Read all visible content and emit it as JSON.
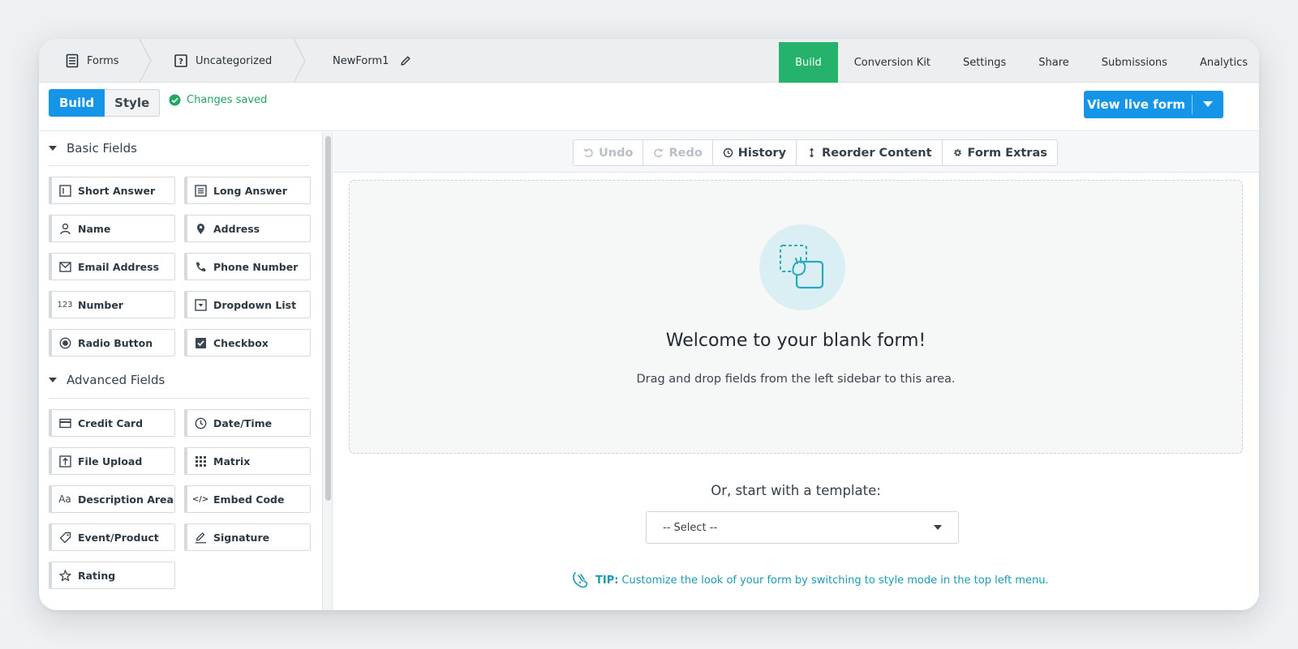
{
  "breadcrumbs": [
    {
      "label": "Forms",
      "icon": "form-doc-icon"
    },
    {
      "label": "Uncategorized",
      "icon": "folder-question-icon"
    },
    {
      "label": "NewForm1",
      "icon": "pencil-icon"
    }
  ],
  "nav_tabs": [
    {
      "label": "Build",
      "active": true
    },
    {
      "label": "Conversion Kit"
    },
    {
      "label": "Settings"
    },
    {
      "label": "Share"
    },
    {
      "label": "Submissions"
    },
    {
      "label": "Analytics"
    }
  ],
  "mode": {
    "build": "Build",
    "style": "Style"
  },
  "status": "Changes saved",
  "live_button": "View live form",
  "sections": {
    "basic": "Basic Fields",
    "advanced": "Advanced Fields"
  },
  "basic_fields": [
    {
      "label": "Short Answer",
      "icon": "short-answer-icon"
    },
    {
      "label": "Long Answer",
      "icon": "long-answer-icon"
    },
    {
      "label": "Name",
      "icon": "person-icon"
    },
    {
      "label": "Address",
      "icon": "map-pin-icon"
    },
    {
      "label": "Email Address",
      "icon": "envelope-icon"
    },
    {
      "label": "Phone Number",
      "icon": "phone-icon"
    },
    {
      "label": "Number",
      "icon": "number-123-icon",
      "glyph": "123"
    },
    {
      "label": "Dropdown List",
      "icon": "dropdown-icon"
    },
    {
      "label": "Radio Button",
      "icon": "radio-icon"
    },
    {
      "label": "Checkbox",
      "icon": "checkbox-icon"
    }
  ],
  "advanced_fields": [
    {
      "label": "Credit Card",
      "icon": "credit-card-icon"
    },
    {
      "label": "Date/Time",
      "icon": "clock-icon"
    },
    {
      "label": "File Upload",
      "icon": "file-upload-icon"
    },
    {
      "label": "Matrix",
      "icon": "matrix-grid-icon"
    },
    {
      "label": "Description Area",
      "icon": "text-aa-icon",
      "glyph": "Aa"
    },
    {
      "label": "Embed Code",
      "icon": "code-icon",
      "glyph": "</>"
    },
    {
      "label": "Event/Product",
      "icon": "tag-icon"
    },
    {
      "label": "Signature",
      "icon": "signature-pen-icon"
    },
    {
      "label": "Rating",
      "icon": "star-icon"
    }
  ],
  "tools": [
    {
      "label": "Undo",
      "disabled": true,
      "icon": "undo-icon"
    },
    {
      "label": "Redo",
      "disabled": true,
      "icon": "redo-icon"
    },
    {
      "label": "History",
      "icon": "history-clock-icon"
    },
    {
      "label": "Reorder Content",
      "icon": "reorder-arrows-icon"
    },
    {
      "label": "Form Extras",
      "icon": "gear-icon"
    }
  ],
  "canvas": {
    "welcome": "Welcome to your blank form!",
    "instructions": "Drag and drop fields from the left sidebar to this area.",
    "template_prompt": "Or, start with a template:",
    "template_select": "-- Select --",
    "tip_label": "TIP:",
    "tip_text": "Customize the look of your form by switching to style mode in the top left menu."
  },
  "colors": {
    "accent_blue": "#1595e8",
    "accent_green": "#25b36b",
    "tip_teal": "#1a9ab5"
  }
}
